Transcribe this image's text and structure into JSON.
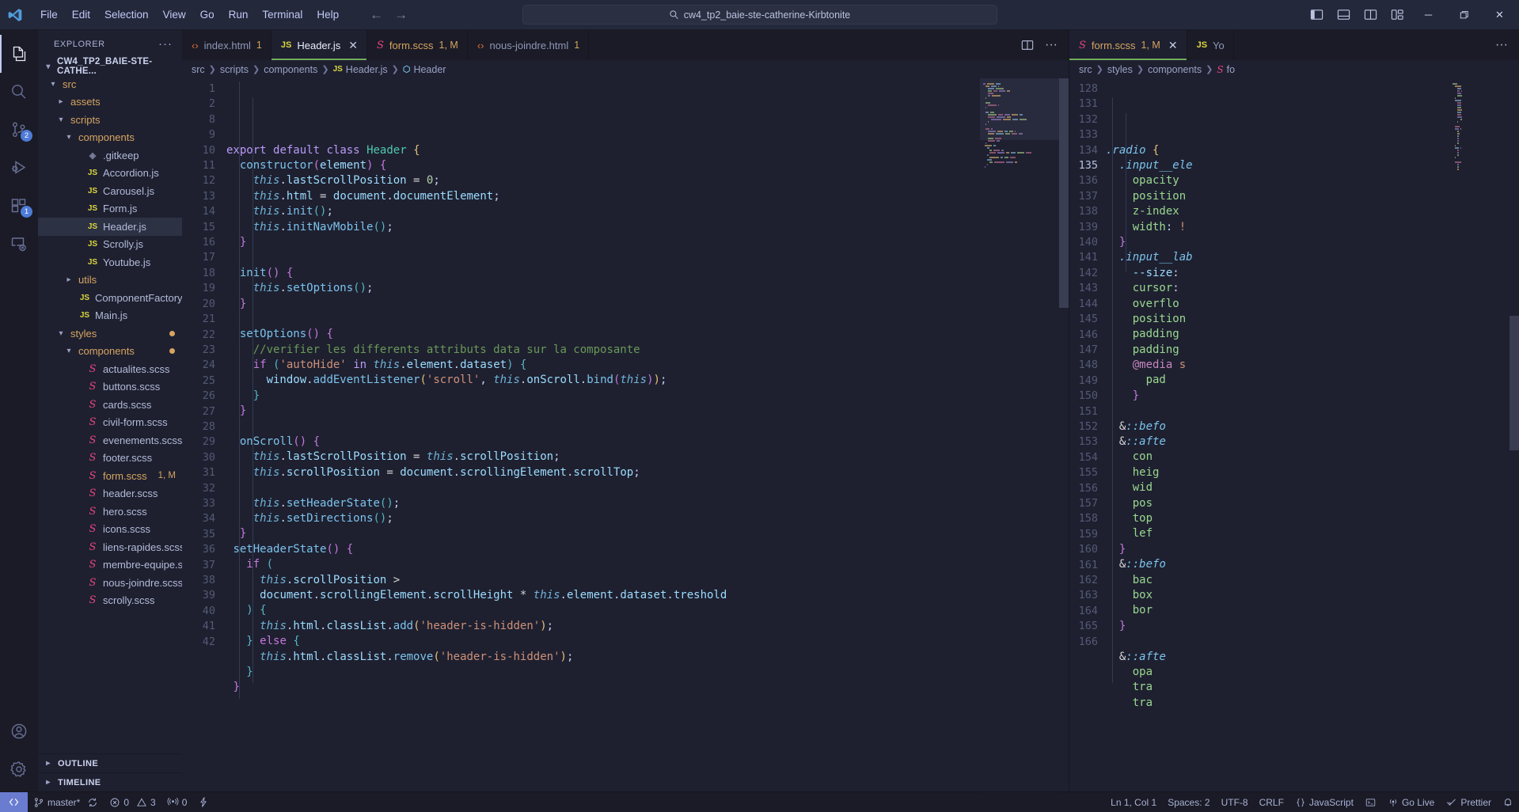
{
  "window": {
    "title": "cw4_tp2_baie-ste-catherine-Kirbtonite",
    "menu": [
      "File",
      "Edit",
      "Selection",
      "View",
      "Go",
      "Run",
      "Terminal",
      "Help"
    ],
    "nav_back": "←",
    "nav_forward": "→",
    "search_placeholder": "cw4_tp2_baie-ste-catherine-Kirbtonite",
    "layout_icons": [
      "toggle-primary-sidebar",
      "toggle-panel",
      "toggle-secondary-sidebar",
      "customize-layout"
    ],
    "controls": {
      "minimize": "─",
      "maximize": "❐",
      "close": "✕"
    }
  },
  "activitybar": {
    "items": [
      {
        "name": "explorer",
        "badge": ""
      },
      {
        "name": "search",
        "badge": ""
      },
      {
        "name": "source-control",
        "badge": "2"
      },
      {
        "name": "run-and-debug",
        "badge": ""
      },
      {
        "name": "extensions",
        "badge": "1"
      },
      {
        "name": "remote-explorer",
        "badge": ""
      }
    ],
    "bottom": [
      {
        "name": "accounts",
        "badge": ""
      },
      {
        "name": "settings",
        "badge": ""
      }
    ]
  },
  "sidebar": {
    "title": "EXPLORER",
    "more_actions": "···",
    "root": "CW4_TP2_BAIE-STE-CATHE...",
    "tree": [
      {
        "label": "src",
        "indent": 1,
        "type": "folder",
        "state": "open",
        "badge": ""
      },
      {
        "label": "assets",
        "indent": 2,
        "type": "folder",
        "state": "closed",
        "badge": ""
      },
      {
        "label": "scripts",
        "indent": 2,
        "type": "folder",
        "state": "open",
        "badge": ""
      },
      {
        "label": "components",
        "indent": 3,
        "type": "folder",
        "state": "open",
        "badge": ""
      },
      {
        "label": ".gitkeep",
        "indent": 4,
        "type": "git",
        "state": "",
        "badge": ""
      },
      {
        "label": "Accordion.js",
        "indent": 4,
        "type": "js",
        "state": "",
        "badge": ""
      },
      {
        "label": "Carousel.js",
        "indent": 4,
        "type": "js",
        "state": "",
        "badge": ""
      },
      {
        "label": "Form.js",
        "indent": 4,
        "type": "js",
        "state": "",
        "badge": ""
      },
      {
        "label": "Header.js",
        "indent": 4,
        "type": "js",
        "state": "selected",
        "badge": ""
      },
      {
        "label": "Scrolly.js",
        "indent": 4,
        "type": "js",
        "state": "",
        "badge": ""
      },
      {
        "label": "Youtube.js",
        "indent": 4,
        "type": "js",
        "state": "",
        "badge": ""
      },
      {
        "label": "utils",
        "indent": 3,
        "type": "folder",
        "state": "closed",
        "badge": ""
      },
      {
        "label": "ComponentFactory...",
        "indent": 3,
        "type": "js",
        "state": "",
        "badge": ""
      },
      {
        "label": "Main.js",
        "indent": 3,
        "type": "js",
        "state": "",
        "badge": ""
      },
      {
        "label": "styles",
        "indent": 2,
        "type": "folder",
        "state": "open",
        "badge": "dot"
      },
      {
        "label": "components",
        "indent": 3,
        "type": "folder",
        "state": "open",
        "badge": "dot"
      },
      {
        "label": "actualites.scss",
        "indent": 4,
        "type": "scss",
        "state": "",
        "badge": ""
      },
      {
        "label": "buttons.scss",
        "indent": 4,
        "type": "scss",
        "state": "",
        "badge": ""
      },
      {
        "label": "cards.scss",
        "indent": 4,
        "type": "scss",
        "state": "",
        "badge": ""
      },
      {
        "label": "civil-form.scss",
        "indent": 4,
        "type": "scss",
        "state": "",
        "badge": ""
      },
      {
        "label": "evenements.scss",
        "indent": 4,
        "type": "scss",
        "state": "",
        "badge": ""
      },
      {
        "label": "footer.scss",
        "indent": 4,
        "type": "scss",
        "state": "",
        "badge": ""
      },
      {
        "label": "form.scss",
        "indent": 4,
        "type": "scss",
        "state": "modified",
        "badge": "1, M"
      },
      {
        "label": "header.scss",
        "indent": 4,
        "type": "scss",
        "state": "",
        "badge": ""
      },
      {
        "label": "hero.scss",
        "indent": 4,
        "type": "scss",
        "state": "",
        "badge": ""
      },
      {
        "label": "icons.scss",
        "indent": 4,
        "type": "scss",
        "state": "",
        "badge": ""
      },
      {
        "label": "liens-rapides.scss",
        "indent": 4,
        "type": "scss",
        "state": "",
        "badge": ""
      },
      {
        "label": "membre-equipe.s...",
        "indent": 4,
        "type": "scss",
        "state": "",
        "badge": ""
      },
      {
        "label": "nous-joindre.scss",
        "indent": 4,
        "type": "scss",
        "state": "",
        "badge": ""
      },
      {
        "label": "scrolly.scss",
        "indent": 4,
        "type": "scss",
        "state": "",
        "badge": ""
      }
    ],
    "sections": [
      {
        "label": "OUTLINE",
        "state": "closed"
      },
      {
        "label": "TIMELINE",
        "state": "closed"
      }
    ]
  },
  "editor_left": {
    "tabs": [
      {
        "label": "index.html",
        "icon": "html",
        "count": "1",
        "active": false,
        "modified": false,
        "closable": false
      },
      {
        "label": "Header.js",
        "icon": "js",
        "count": "",
        "active": true,
        "modified": false,
        "closable": true
      },
      {
        "label": "form.scss",
        "icon": "scss",
        "count": "1, M",
        "active": false,
        "modified": true,
        "closable": false
      },
      {
        "label": "nous-joindre.html",
        "icon": "html",
        "count": "1",
        "active": false,
        "modified": false,
        "closable": false
      }
    ],
    "actions": [
      "split-editor",
      "more-actions"
    ],
    "breadcrumb": [
      {
        "label": "src",
        "icon": ""
      },
      {
        "label": "scripts",
        "icon": ""
      },
      {
        "label": "components",
        "icon": ""
      },
      {
        "label": "Header.js",
        "icon": "js"
      },
      {
        "label": "Header",
        "icon": "class"
      }
    ],
    "first_line_number": 1,
    "lines": [
      {
        "n": "1",
        "html": "<span class='k'>export</span> <span class='k'>default</span> <span class='k'>class</span> <span class='cls'>Header</span> <span class='br1'>{</span>"
      },
      {
        "n": "2",
        "html": "  <span class='fn'>constructor</span><span class='br2'>(</span><span class='pr'>element</span><span class='br2'>)</span> <span class='br2'>{</span>"
      },
      {
        "n": "8",
        "html": "    <span class='th'>this</span>.<span class='var'>lastScrollPosition</span> <span class='op'>=</span> <span class='num'>0</span>;"
      },
      {
        "n": "9",
        "html": "    <span class='th'>this</span>.<span class='var'>html</span> <span class='op'>=</span> <span class='var'>document</span>.<span class='var'>documentElement</span>;"
      },
      {
        "n": "10",
        "html": "    <span class='th'>this</span>.<span class='fn'>init</span><span class='br3'>()</span>;"
      },
      {
        "n": "11",
        "html": "    <span class='th'>this</span>.<span class='fn'>initNavMobile</span><span class='br3'>()</span>;"
      },
      {
        "n": "12",
        "html": "  <span class='br2'>}</span>"
      },
      {
        "n": "13",
        "html": ""
      },
      {
        "n": "14",
        "html": "  <span class='fn'>init</span><span class='br2'>()</span> <span class='br2'>{</span>"
      },
      {
        "n": "15",
        "html": "    <span class='th'>this</span>.<span class='fn'>setOptions</span><span class='br3'>()</span>;"
      },
      {
        "n": "16",
        "html": "  <span class='br2'>}</span>"
      },
      {
        "n": "17",
        "html": ""
      },
      {
        "n": "18",
        "html": "  <span class='fn'>setOptions</span><span class='br2'>()</span> <span class='br2'>{</span>"
      },
      {
        "n": "19",
        "html": "    <span class='cm'>//verifier les differents attributs data sur la composante</span>"
      },
      {
        "n": "20",
        "html": "    <span class='ctl'>if</span> <span class='br3'>(</span><span class='str'>'autoHide'</span> <span class='k'>in</span> <span class='th'>this</span>.<span class='var'>element</span>.<span class='var'>dataset</span><span class='br3'>)</span> <span class='br3'>{</span>"
      },
      {
        "n": "21",
        "html": "      <span class='var'>window</span>.<span class='fn'>addEventListener</span><span class='br1'>(</span><span class='str'>'scroll'</span>, <span class='th'>this</span>.<span class='var'>onScroll</span>.<span class='fn'>bind</span><span class='br2'>(</span><span class='th'>this</span><span class='br2'>)</span><span class='br1'>)</span>;"
      },
      {
        "n": "22",
        "html": "    <span class='br3'>}</span>"
      },
      {
        "n": "23",
        "html": "  <span class='br2'>}</span>"
      },
      {
        "n": "24",
        "html": ""
      },
      {
        "n": "25",
        "html": "  <span class='fn'>onScroll</span><span class='br2'>()</span> <span class='br2'>{</span>"
      },
      {
        "n": "26",
        "html": "    <span class='th'>this</span>.<span class='var'>lastScrollPosition</span> <span class='op'>=</span> <span class='th'>this</span>.<span class='var'>scrollPosition</span>;"
      },
      {
        "n": "27",
        "html": "    <span class='th'>this</span>.<span class='var'>scrollPosition</span> <span class='op'>=</span> <span class='var'>document</span>.<span class='var'>scrollingElement</span>.<span class='var'>scrollTop</span>;"
      },
      {
        "n": "28",
        "html": ""
      },
      {
        "n": "29",
        "html": "    <span class='th'>this</span>.<span class='fn'>setHeaderState</span><span class='br3'>()</span>;"
      },
      {
        "n": "30",
        "html": "    <span class='th'>this</span>.<span class='fn'>setDirections</span><span class='br3'>()</span>;"
      },
      {
        "n": "31",
        "html": "  <span class='br2'>}</span>"
      },
      {
        "n": "32",
        "html": " <span class='fn'>setHeaderState</span><span class='br2'>()</span> <span class='br2'>{</span>"
      },
      {
        "n": "33",
        "html": "   <span class='ctl'>if</span> <span class='br3'>(</span>"
      },
      {
        "n": "34",
        "html": "     <span class='th'>this</span>.<span class='var'>scrollPosition</span> <span class='op'>&gt;</span>"
      },
      {
        "n": "35",
        "html": "     <span class='var'>document</span>.<span class='var'>scrollingElement</span>.<span class='var'>scrollHeight</span> <span class='op'>*</span> <span class='th'>this</span>.<span class='var'>element</span>.<span class='var'>dataset</span>.<span class='var'>treshold</span>"
      },
      {
        "n": "36",
        "html": "   <span class='br3'>)</span> <span class='br3'>{</span>"
      },
      {
        "n": "37",
        "html": "     <span class='th'>this</span>.<span class='var'>html</span>.<span class='var'>classList</span>.<span class='fn'>add</span><span class='br1'>(</span><span class='str'>'header-is-hidden'</span><span class='br1'>)</span>;"
      },
      {
        "n": "38",
        "html": "   <span class='br3'>}</span> <span class='ctl'>else</span> <span class='br3'>{</span>"
      },
      {
        "n": "39",
        "html": "     <span class='th'>this</span>.<span class='var'>html</span>.<span class='var'>classList</span>.<span class='fn'>remove</span><span class='br1'>(</span><span class='str'>'header-is-hidden'</span><span class='br1'>)</span>;"
      },
      {
        "n": "40",
        "html": "   <span class='br3'>}</span>"
      },
      {
        "n": "41",
        "html": " <span class='br2'>}</span>"
      },
      {
        "n": "42",
        "html": ""
      }
    ]
  },
  "editor_right": {
    "tabs": [
      {
        "label": "form.scss",
        "icon": "scss",
        "count": "1, M",
        "active": true,
        "modified": true,
        "closable": true
      },
      {
        "label": "Yo",
        "icon": "js",
        "count": "",
        "active": false,
        "modified": false,
        "closable": false
      }
    ],
    "actions": [
      "more-actions"
    ],
    "breadcrumb": [
      {
        "label": "src",
        "icon": ""
      },
      {
        "label": "styles",
        "icon": ""
      },
      {
        "label": "components",
        "icon": ""
      },
      {
        "label": "fo",
        "icon": "scss"
      }
    ],
    "cursor_line": "135",
    "lines": [
      {
        "n": "128",
        "html": "<span class='sel-sc'>.radio</span> <span class='br1'>{</span>"
      },
      {
        "n": "131",
        "html": "  <span class='sel-sc'>.input__ele</span>"
      },
      {
        "n": "132",
        "html": "    <span class='prop'>opacity</span>"
      },
      {
        "n": "133",
        "html": "    <span class='prop'>position</span>"
      },
      {
        "n": "134",
        "html": "    <span class='prop'>z-index</span>"
      },
      {
        "n": "135",
        "html": "    <span class='prop'>width</span>: <span class='str'>!</span>"
      },
      {
        "n": "136",
        "html": "  <span class='br2'>}</span>"
      },
      {
        "n": "137",
        "html": "  <span class='sel-sc'>.input__lab</span>"
      },
      {
        "n": "138",
        "html": "    <span class='var'>--size</span>:"
      },
      {
        "n": "139",
        "html": "    <span class='prop'>cursor</span>:"
      },
      {
        "n": "140",
        "html": "    <span class='prop'>overflo</span>"
      },
      {
        "n": "141",
        "html": "    <span class='prop'>position</span>"
      },
      {
        "n": "142",
        "html": "    <span class='prop'>padding</span>"
      },
      {
        "n": "143",
        "html": "    <span class='prop'>padding</span>"
      },
      {
        "n": "144",
        "html": "    <span class='k2'>@media</span> <span class='str'>s</span>"
      },
      {
        "n": "145",
        "html": "      <span class='prop'>pad</span>"
      },
      {
        "n": "146",
        "html": "    <span class='br2'>}</span>"
      },
      {
        "n": "147",
        "html": ""
      },
      {
        "n": "148",
        "html": "  <span class='op'>&amp;</span><span class='sel-sc'>::befo</span>"
      },
      {
        "n": "149",
        "html": "  <span class='op'>&amp;</span><span class='sel-sc'>::afte</span>"
      },
      {
        "n": "150",
        "html": "    <span class='prop'>con</span>"
      },
      {
        "n": "151",
        "html": "    <span class='prop'>heig</span>"
      },
      {
        "n": "152",
        "html": "    <span class='prop'>wid</span>"
      },
      {
        "n": "153",
        "html": "    <span class='prop'>pos</span>"
      },
      {
        "n": "154",
        "html": "    <span class='prop'>top</span>"
      },
      {
        "n": "155",
        "html": "    <span class='prop'>lef</span>"
      },
      {
        "n": "156",
        "html": "  <span class='br2'>}</span>"
      },
      {
        "n": "157",
        "html": "  <span class='op'>&amp;</span><span class='sel-sc'>::befo</span>"
      },
      {
        "n": "158",
        "html": "    <span class='prop'>bac</span>"
      },
      {
        "n": "159",
        "html": "    <span class='prop'>box</span>"
      },
      {
        "n": "160",
        "html": "    <span class='prop'>bor</span>"
      },
      {
        "n": "161",
        "html": "  <span class='br2'>}</span>"
      },
      {
        "n": "162",
        "html": ""
      },
      {
        "n": "163",
        "html": "  <span class='op'>&amp;</span><span class='sel-sc'>::afte</span>"
      },
      {
        "n": "164",
        "html": "    <span class='prop'>opa</span>"
      },
      {
        "n": "165",
        "html": "    <span class='prop'>tra</span>"
      },
      {
        "n": "166",
        "html": "    <span class='prop'>tra</span>"
      }
    ]
  },
  "statusbar": {
    "remote_icon": "remote-window",
    "left": [
      {
        "name": "branch",
        "icon": "source-control",
        "label": "master*"
      },
      {
        "name": "sync",
        "icon": "sync",
        "label": ""
      },
      {
        "name": "errors",
        "icon": "error",
        "label": "0"
      },
      {
        "name": "warnings",
        "icon": "warning",
        "label": "3"
      },
      {
        "name": "ports",
        "icon": "radio-tower",
        "label": "0"
      },
      {
        "name": "live-share",
        "icon": "zap",
        "label": ""
      }
    ],
    "right": [
      {
        "name": "cursor-position",
        "icon": "",
        "label": "Ln 1, Col 1"
      },
      {
        "name": "indentation",
        "icon": "",
        "label": "Spaces: 2"
      },
      {
        "name": "encoding",
        "icon": "",
        "label": "UTF-8"
      },
      {
        "name": "eol",
        "icon": "",
        "label": "CRLF"
      },
      {
        "name": "language-mode",
        "icon": "braces",
        "label": "JavaScript"
      },
      {
        "name": "terminal-toggle",
        "icon": "terminal",
        "label": ""
      },
      {
        "name": "go-live",
        "icon": "broadcast",
        "label": "Go Live"
      },
      {
        "name": "prettier",
        "icon": "check",
        "label": "Prettier"
      },
      {
        "name": "notifications",
        "icon": "bell",
        "label": ""
      }
    ]
  },
  "colors": {
    "accent": "#7aa2f7",
    "tab_active_border": "#71ad5a",
    "modified": "#d7a45f",
    "remote_bg": "#6a7cd0",
    "badge_bg": "#4f7bd8"
  }
}
